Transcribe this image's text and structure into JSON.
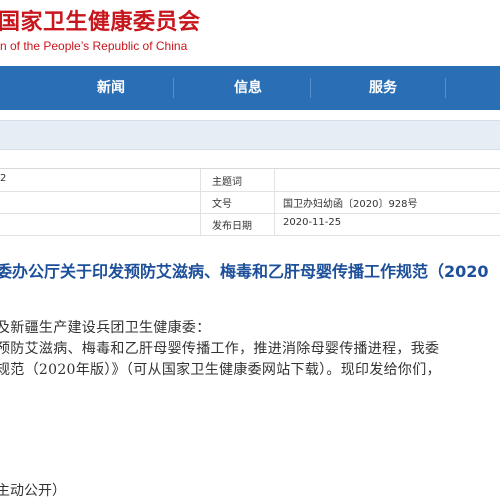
{
  "header": {
    "title_cn": "国家卫生健康委员会",
    "title_en": "n of the People’s Republic of China"
  },
  "nav": {
    "items": [
      {
        "label": "新闻"
      },
      {
        "label": "信息"
      },
      {
        "label": "服务"
      }
    ]
  },
  "meta": {
    "left_value": "2",
    "rows": [
      {
        "label": "主题词",
        "value": ""
      },
      {
        "label": "文号",
        "value": "国卫办妇幼函〔2020〕928号"
      },
      {
        "label": "发布日期",
        "value": "2020-11-25"
      }
    ]
  },
  "document": {
    "title": "委办公厅关于印发预防艾滋病、梅毒和乙肝母婴传播工作规范（2020",
    "paragraphs": [
      "及新疆生产建设兵团卫生健康委：",
      "预防艾滋病、梅毒和乙肝母婴传播工作，推进消除母婴传播进程，我委",
      "规范（2020年版）》（可从国家卫生健康委网站下载）。现印发给你们，"
    ],
    "footer": "主动公开）"
  },
  "colors": {
    "brand_red": "#c8161d",
    "nav_blue": "#2a6fb6",
    "title_blue": "#1d4f9a"
  }
}
